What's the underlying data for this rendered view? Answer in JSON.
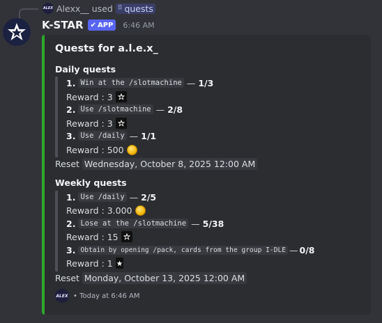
{
  "reply": {
    "user": "Alexx__",
    "used_text": "used",
    "command": "quests",
    "user_avatar_text": "ALEX"
  },
  "message": {
    "author": "K-STAR",
    "badge": "APP",
    "time": "6:46 AM"
  },
  "embed": {
    "accent_color": "#2ca82c",
    "title": "Quests for a.l.e.x_",
    "daily": {
      "title": "Daily quests",
      "quests": [
        {
          "num": "1.",
          "task": "Win at the /slotmachine",
          "progress": "1/3",
          "reward_label": "Reward : 3",
          "reward_icon": "star-card-icon"
        },
        {
          "num": "2.",
          "task": "Use /slotmachine",
          "progress": "2/8",
          "reward_label": "Reward : 3",
          "reward_icon": "star-card-icon"
        },
        {
          "num": "3.",
          "task": "Use /daily",
          "progress": "1/1",
          "reward_label": "Reward : 500",
          "reward_icon": "coin-icon"
        }
      ],
      "reset_label": "Reset",
      "reset_date": "Wednesday, October 8, 2025 12:00 AM"
    },
    "weekly": {
      "title": "Weekly quests",
      "quests": [
        {
          "num": "1.",
          "task": "Use /daily",
          "progress": "2/5",
          "reward_label": "Reward : 3.000",
          "reward_icon": "coin-icon"
        },
        {
          "num": "2.",
          "task": "Lose at the /slotmachine",
          "progress": "5/38",
          "reward_label": "Reward : 15",
          "reward_icon": "star-card-icon"
        },
        {
          "num": "3.",
          "task": "Obtain by opening /pack, cards from the group I-DLE",
          "progress": "0/8",
          "reward_label": "Reward : 1",
          "reward_icon": "card-icon"
        }
      ],
      "reset_label": "Reset",
      "reset_date": "Monday, October 13, 2025 12:00 AM"
    },
    "footer": {
      "text": "• Today at 6:46 AM",
      "icon_text": "ALEX"
    }
  }
}
